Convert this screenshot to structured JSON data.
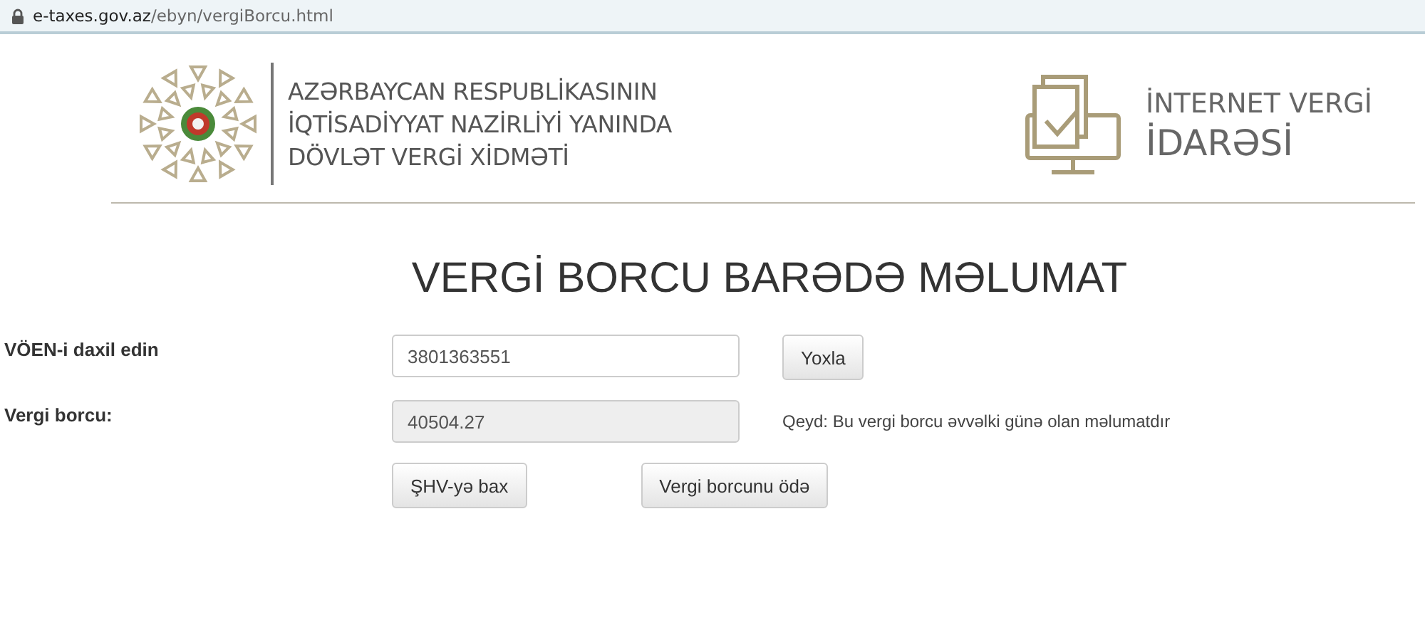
{
  "address_bar": {
    "domain": "e-taxes.gov.az",
    "path": "/ebyn/vergiBorcu.html"
  },
  "header": {
    "org_lines": [
      "AZƏRBAYCAN RESPUBLİKASININ",
      "İQTİSADİYYAT NAZİRLİYİ YANINDA",
      "DÖVLƏT VERGİ XİDMƏTİ"
    ],
    "service_lines": [
      "İNTERNET VERGİ",
      "İDARƏSİ"
    ]
  },
  "title": "VERGİ BORCU BARƏDƏ MƏLUMAT",
  "form": {
    "voen_label": "VÖEN-i daxil edin",
    "voen_value": "3801363551",
    "check_button": "Yoxla",
    "debt_label": "Vergi borcu:",
    "debt_value": "40504.27",
    "debt_disabled": true,
    "note": "Qeyd: Bu vergi borcu əvvəlki günə olan məlumatdır",
    "buttons": [
      "ŞHV-yə bax",
      "Vergi borcunu ödə"
    ]
  }
}
